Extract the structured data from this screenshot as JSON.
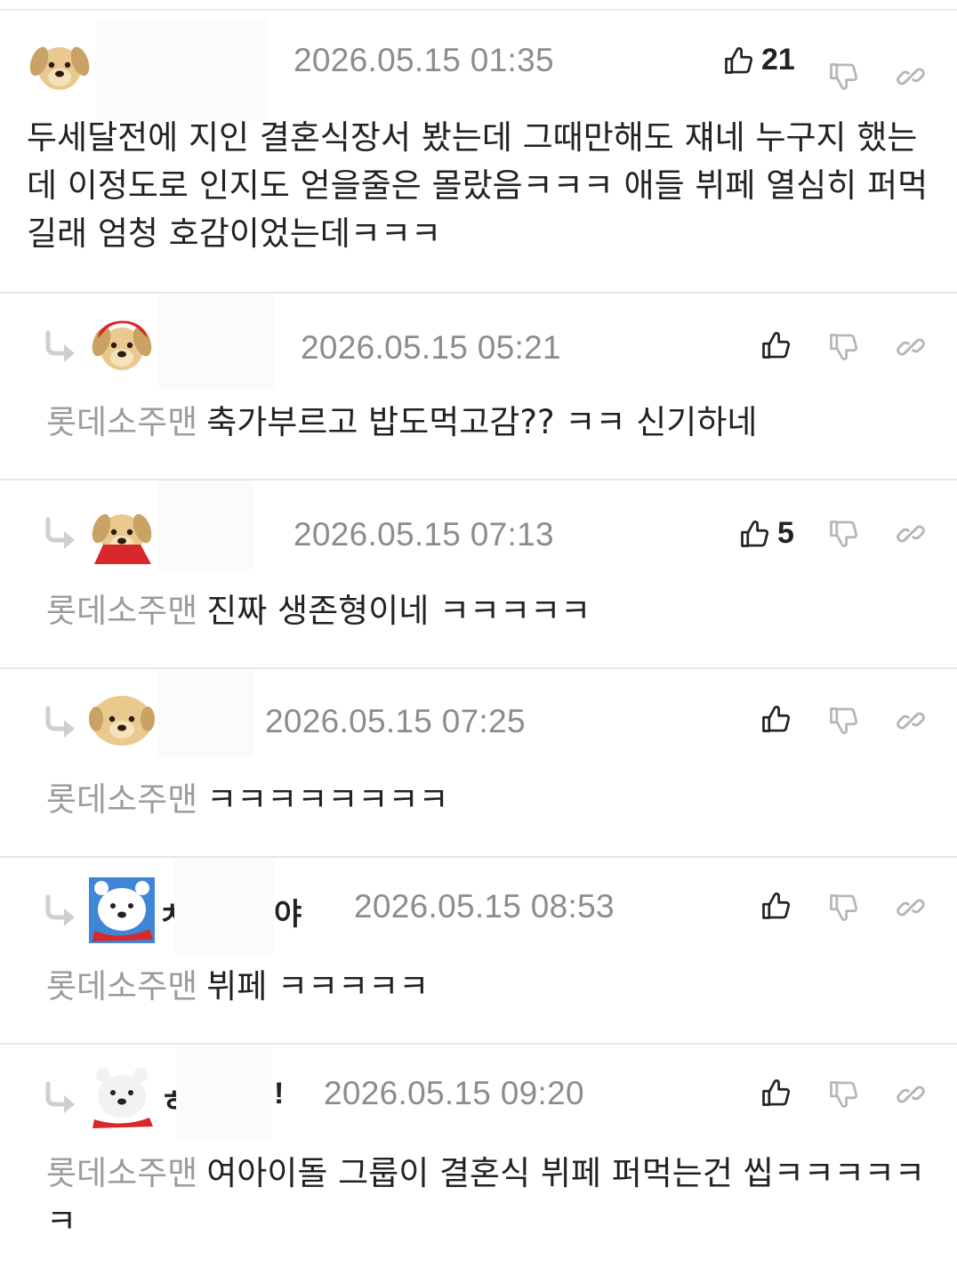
{
  "comments": [
    {
      "type": "comment",
      "nickname": "",
      "date": "2026.05.15 01:35",
      "likes": "21",
      "text": "두세달전에 지인 결혼식장서 봤는데 그때만해도 쟤네 누구지 했는데 이정도로 인지도 얻을줄은 몰랐음ㅋㅋㅋ 애들 뷔페 열심히 퍼먹길래 엄청 호감이었는데ㅋㅋㅋ"
    },
    {
      "type": "reply",
      "nickname": "",
      "date": "2026.05.15 05:21",
      "likes": "",
      "mention": "롯데소주맨",
      "text": "축가부르고 밥도먹고감?? ㅋㅋ 신기하네"
    },
    {
      "type": "reply",
      "nickname": "",
      "date": "2026.05.15 07:13",
      "likes": "5",
      "mention": "롯데소주맨",
      "text": "진짜 생존형이네 ㅋㅋㅋㅋㅋ"
    },
    {
      "type": "reply",
      "nickname": "",
      "date": "2026.05.15 07:25",
      "likes": "",
      "mention": "롯데소주맨",
      "text": "ㅋㅋㅋㅋㅋㅋㅋㅋ"
    },
    {
      "type": "reply",
      "nickname_start": "ㅊ",
      "nickname_end": "야",
      "date": "2026.05.15 08:53",
      "likes": "",
      "mention": "롯데소주맨",
      "text": "뷔페 ㅋㅋㅋㅋㅋ"
    },
    {
      "type": "reply",
      "nickname_start": "ㅎ",
      "nickname_end": "!",
      "date": "2026.05.15 09:20",
      "likes": "",
      "mention": "롯데소주맨",
      "text": "여아이돌 그룹이 결혼식 뷔페 퍼먹는건 씹ㅋㅋㅋㅋㅋㅋ"
    }
  ],
  "icons": {
    "like": "thumbs-up-icon",
    "dislike": "thumbs-down-icon",
    "link": "link-icon",
    "reply": "reply-arrow-icon"
  },
  "colors": {
    "date": "#8c8c8c",
    "mention": "#9b9b9b",
    "divider": "#e6e6e6",
    "reply_arrow": "#cfcfcf"
  }
}
